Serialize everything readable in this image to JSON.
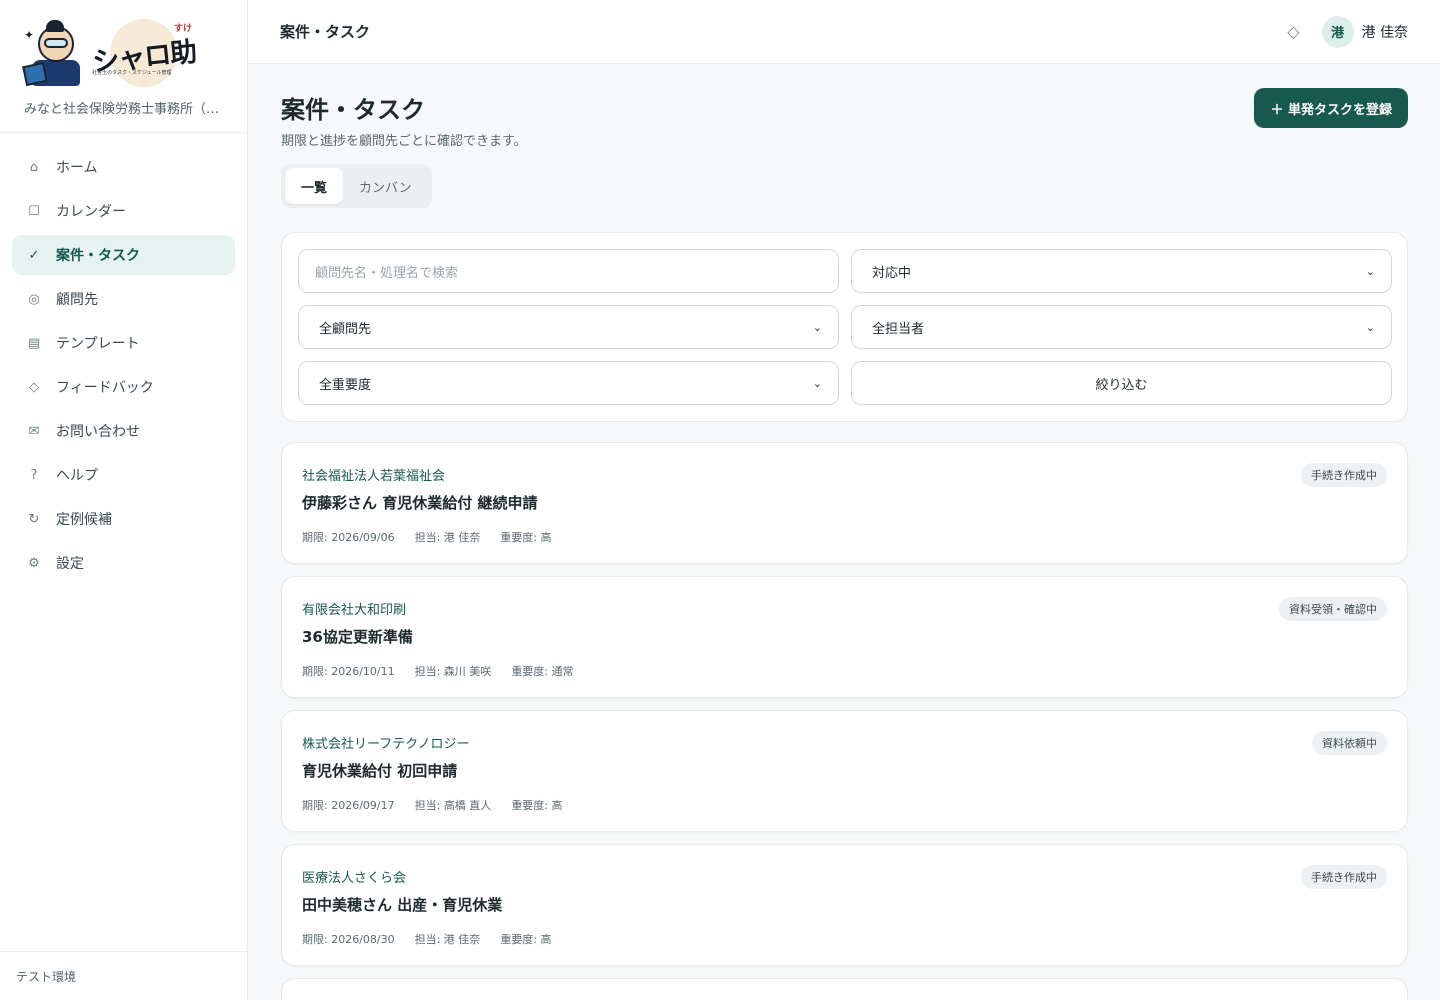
{
  "app": {
    "logo_text": "シャロ助",
    "logo_ruby": "すけ",
    "logo_tagline": "社労士のタスク・スケジュール管理",
    "office_name": "みなと社会保険労務士事務所（デ…"
  },
  "sidebar": {
    "items": [
      {
        "label": "ホーム",
        "icon": "⌂",
        "active": false
      },
      {
        "label": "カレンダー",
        "icon": "☐",
        "active": false
      },
      {
        "label": "案件・タスク",
        "icon": "✓",
        "active": true
      },
      {
        "label": "顧問先",
        "icon": "◎",
        "active": false
      },
      {
        "label": "テンプレート",
        "icon": "▤",
        "active": false
      },
      {
        "label": "フィードバック",
        "icon": "◇",
        "active": false
      },
      {
        "label": "お問い合わせ",
        "icon": "✉",
        "active": false
      },
      {
        "label": "ヘルプ",
        "icon": "?",
        "active": false
      },
      {
        "label": "定例候補",
        "icon": "↻",
        "active": false
      },
      {
        "label": "設定",
        "icon": "⚙",
        "active": false
      }
    ],
    "footer": "テスト環境"
  },
  "topbar": {
    "title": "案件・タスク",
    "bell_icon": "◇",
    "avatar_initial": "港",
    "user_name": "港 佳奈"
  },
  "page": {
    "title": "案件・タスク",
    "subtitle": "期限と進捗を顧問先ごとに確認できます。",
    "add_button": "＋ 単発タスクを登録",
    "tabs": [
      {
        "label": "一覧",
        "active": true
      },
      {
        "label": "カンバン",
        "active": false
      }
    ]
  },
  "filters": {
    "search_placeholder": "顧問先名・処理名で検索",
    "status": "対応中",
    "client": "全顧問先",
    "assignee": "全担当者",
    "priority": "全重要度",
    "submit_label": "絞り込む"
  },
  "tasks": [
    {
      "client": "社会福祉法人若葉福祉会",
      "title": "伊藤彩さん 育児休業給付 継続申請",
      "due": "期限: 2026/09/06",
      "assignee": "担当: 港 佳奈",
      "priority": "重要度: 高",
      "status": "手続き作成中"
    },
    {
      "client": "有限会社大和印刷",
      "title": "36協定更新準備",
      "due": "期限: 2026/10/11",
      "assignee": "担当: 森川 美咲",
      "priority": "重要度: 通常",
      "status": "資料受領・確認中"
    },
    {
      "client": "株式会社リーフテクノロジー",
      "title": "育児休業給付 初回申請",
      "due": "期限: 2026/09/17",
      "assignee": "担当: 高橋 直人",
      "priority": "重要度: 高",
      "status": "資料依頼中"
    },
    {
      "client": "医療法人さくら会",
      "title": "田中美穂さん 出産・育児休業",
      "due": "期限: 2026/08/30",
      "assignee": "担当: 港 佳奈",
      "priority": "重要度: 高",
      "status": "手続き作成中"
    }
  ]
}
